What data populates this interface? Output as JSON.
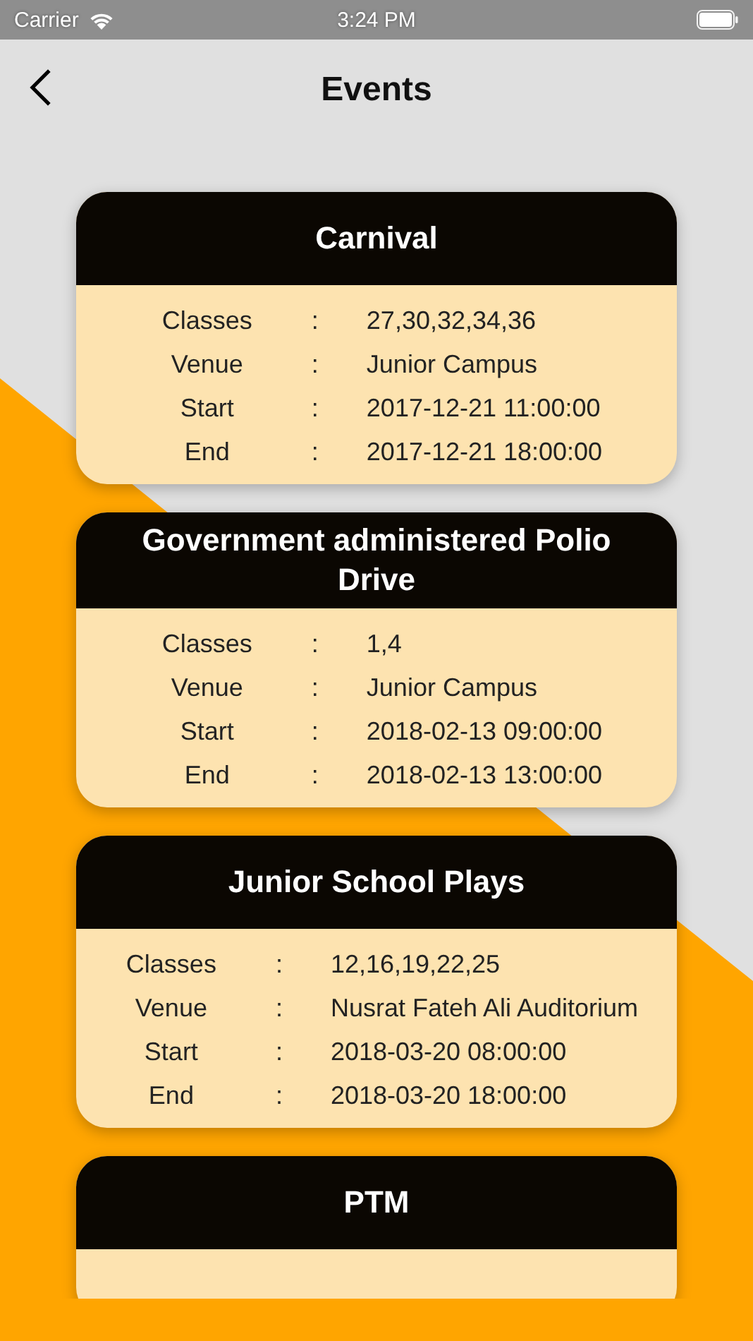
{
  "status_bar": {
    "carrier": "Carrier",
    "time": "3:24 PM"
  },
  "nav": {
    "title": "Events"
  },
  "events": [
    {
      "title": "Carnival",
      "details": [
        {
          "label": "Classes",
          "separator": ":",
          "value": "27,30,32,34,36"
        },
        {
          "label": "Venue",
          "separator": ":",
          "value": "Junior Campus"
        },
        {
          "label": "Start",
          "separator": ":",
          "value": "2017-12-21 11:00:00"
        },
        {
          "label": "End",
          "separator": ":",
          "value": "2017-12-21 18:00:00"
        }
      ]
    },
    {
      "title": "Government administered Polio Drive",
      "details": [
        {
          "label": "Classes",
          "separator": ":",
          "value": "1,4"
        },
        {
          "label": "Venue",
          "separator": ":",
          "value": "Junior Campus"
        },
        {
          "label": "Start",
          "separator": ":",
          "value": "2018-02-13 09:00:00"
        },
        {
          "label": "End",
          "separator": ":",
          "value": "2018-02-13 13:00:00"
        }
      ]
    },
    {
      "title": "Junior School Plays",
      "details": [
        {
          "label": "Classes",
          "separator": ":",
          "value": "12,16,19,22,25"
        },
        {
          "label": "Venue",
          "separator": ":",
          "value": "Nusrat Fateh Ali Auditorium"
        },
        {
          "label": "Start",
          "separator": ":",
          "value": "2018-03-20 08:00:00"
        },
        {
          "label": "End",
          "separator": ":",
          "value": "2018-03-20 18:00:00"
        }
      ]
    },
    {
      "title": "PTM"
    }
  ]
}
